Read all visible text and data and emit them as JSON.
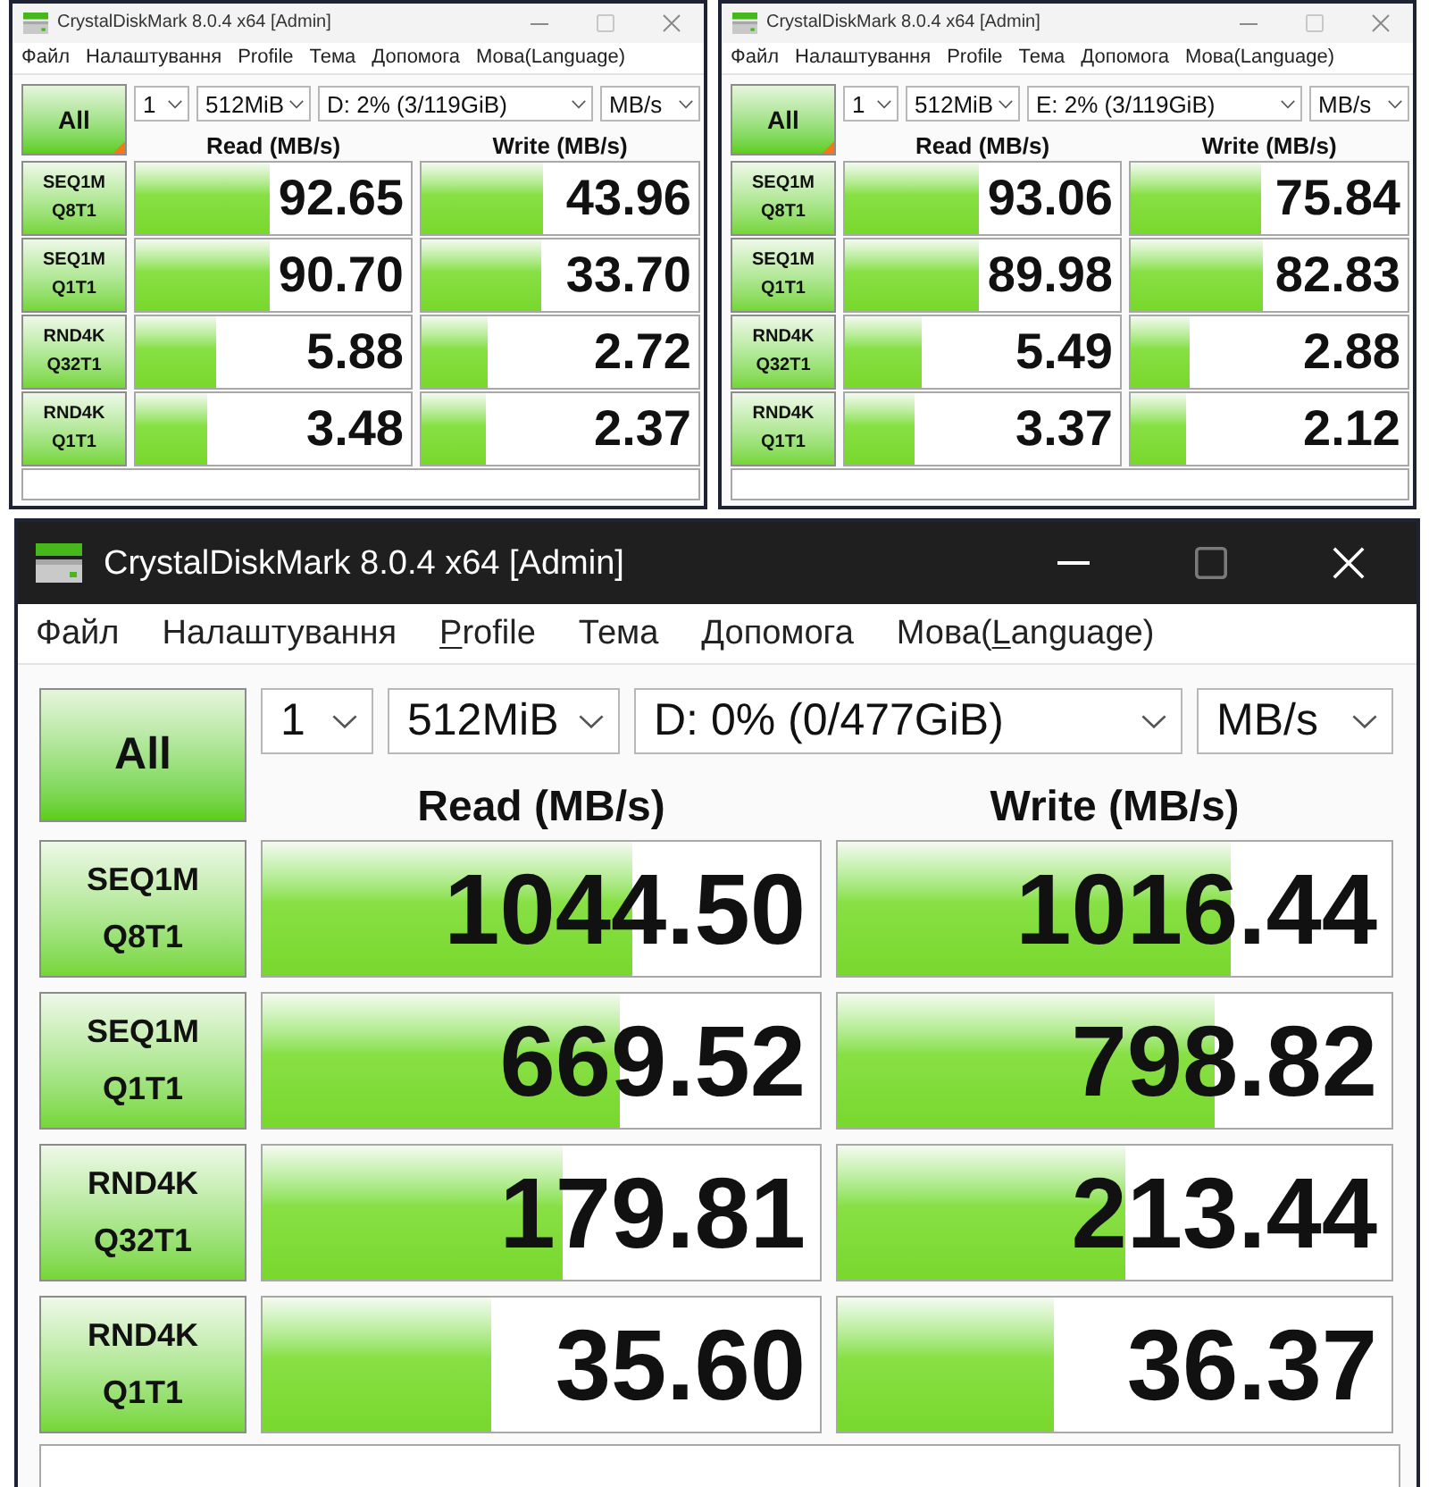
{
  "top_windows": [
    {
      "title": "CrystalDiskMark 8.0.4 x64 [Admin]",
      "active": false,
      "menu": [
        {
          "label": "Файл"
        },
        {
          "label": "Налаштування"
        },
        {
          "label": "Profile"
        },
        {
          "label": "Тема"
        },
        {
          "label": "Допомога"
        },
        {
          "label": "Мова(Language)"
        }
      ],
      "all_button": {
        "label": "All",
        "corner_flag": true
      },
      "settings": {
        "runs": "1",
        "size": "512MiB",
        "drive": "D: 2% (3/119GiB)",
        "unit": "MB/s"
      },
      "headers": {
        "read": "Read (MB/s)",
        "write": "Write (MB/s)"
      },
      "rows": [
        {
          "test": "SEQ1M",
          "params": "Q8T1",
          "read": {
            "value": "92.65",
            "level": 0.49
          },
          "write": {
            "value": "43.96",
            "level": 0.44
          }
        },
        {
          "test": "SEQ1M",
          "params": "Q1T1",
          "read": {
            "value": "90.70",
            "level": 0.49
          },
          "write": {
            "value": "33.70",
            "level": 0.43
          }
        },
        {
          "test": "RND4K",
          "params": "Q32T1",
          "read": {
            "value": "5.88",
            "level": 0.29
          },
          "write": {
            "value": "2.72",
            "level": 0.24
          }
        },
        {
          "test": "RND4K",
          "params": "Q1T1",
          "read": {
            "value": "3.48",
            "level": 0.26
          },
          "write": {
            "value": "2.37",
            "level": 0.23
          }
        }
      ]
    },
    {
      "title": "CrystalDiskMark 8.0.4 x64 [Admin]",
      "active": false,
      "menu": [
        {
          "label": "Файл"
        },
        {
          "label": "Налаштування"
        },
        {
          "label": "Profile"
        },
        {
          "label": "Тема"
        },
        {
          "label": "Допомога"
        },
        {
          "label": "Мова(Language)"
        }
      ],
      "all_button": {
        "label": "All",
        "corner_flag": true
      },
      "settings": {
        "runs": "1",
        "size": "512MiB",
        "drive": "E: 2% (3/119GiB)",
        "unit": "MB/s"
      },
      "headers": {
        "read": "Read (MB/s)",
        "write": "Write (MB/s)"
      },
      "rows": [
        {
          "test": "SEQ1M",
          "params": "Q8T1",
          "read": {
            "value": "93.06",
            "level": 0.49
          },
          "write": {
            "value": "75.84",
            "level": 0.47
          }
        },
        {
          "test": "SEQ1M",
          "params": "Q1T1",
          "read": {
            "value": "89.98",
            "level": 0.49
          },
          "write": {
            "value": "82.83",
            "level": 0.48
          }
        },
        {
          "test": "RND4K",
          "params": "Q32T1",
          "read": {
            "value": "5.49",
            "level": 0.28
          },
          "write": {
            "value": "2.88",
            "level": 0.21
          }
        },
        {
          "test": "RND4K",
          "params": "Q1T1",
          "read": {
            "value": "3.37",
            "level": 0.25
          },
          "write": {
            "value": "2.12",
            "level": 0.2
          }
        }
      ]
    }
  ],
  "main_window": {
    "title": "CrystalDiskMark 8.0.4 x64 [Admin]",
    "active": true,
    "menu": [
      {
        "label": "Файл"
      },
      {
        "label": "Налаштування"
      },
      {
        "segments": [
          {
            "text": "P",
            "underlined": true
          },
          {
            "text": "rofile",
            "underlined": false
          }
        ]
      },
      {
        "label": "Тема"
      },
      {
        "label": "Допомога"
      },
      {
        "segments": [
          {
            "text": "Мова(",
            "underlined": false
          },
          {
            "text": "L",
            "underlined": true
          },
          {
            "text": "anguage)",
            "underlined": false
          }
        ]
      }
    ],
    "all_button": {
      "label": "All",
      "corner_flag": false
    },
    "settings": {
      "runs": "1",
      "size": "512MiB",
      "drive": "D: 0% (0/477GiB)",
      "unit": "MB/s"
    },
    "headers": {
      "read": "Read (MB/s)",
      "write": "Write (MB/s)"
    },
    "rows": [
      {
        "test": "SEQ1M",
        "params": "Q8T1",
        "read": {
          "value": "1044.50",
          "level": 0.665
        },
        "write": {
          "value": "1016.44",
          "level": 0.71
        }
      },
      {
        "test": "SEQ1M",
        "params": "Q1T1",
        "read": {
          "value": "669.52",
          "level": 0.64
        },
        "write": {
          "value": "798.82",
          "level": 0.68
        }
      },
      {
        "test": "RND4K",
        "params": "Q32T1",
        "read": {
          "value": "179.81",
          "level": 0.54
        },
        "write": {
          "value": "213.44",
          "level": 0.52
        }
      },
      {
        "test": "RND4K",
        "params": "Q1T1",
        "read": {
          "value": "35.60",
          "level": 0.41
        },
        "write": {
          "value": "36.37",
          "level": 0.39
        }
      }
    ]
  }
}
